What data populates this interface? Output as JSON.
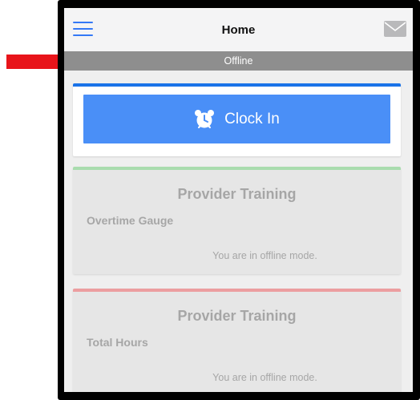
{
  "header": {
    "title": "Home",
    "menu_icon": "hamburger-menu-icon",
    "mail_icon": "mail-icon"
  },
  "status_bar": {
    "label": "Offline"
  },
  "clock_in": {
    "label": "Clock In",
    "icon": "alarm-clock-icon"
  },
  "widgets": [
    {
      "title": "Provider Training",
      "subtitle": "Overtime Gauge",
      "message": "You are in offline mode.",
      "accent": "#a9dcae"
    },
    {
      "title": "Provider Training",
      "subtitle": "Total Hours",
      "message": "You are in offline mode.",
      "accent": "#ec9ea0"
    }
  ],
  "colors": {
    "accent_blue": "#1a73e8",
    "button_blue": "#4a8ff7",
    "offline_gray": "#8e8e8e",
    "annotation_arrow": "#e8141a"
  }
}
